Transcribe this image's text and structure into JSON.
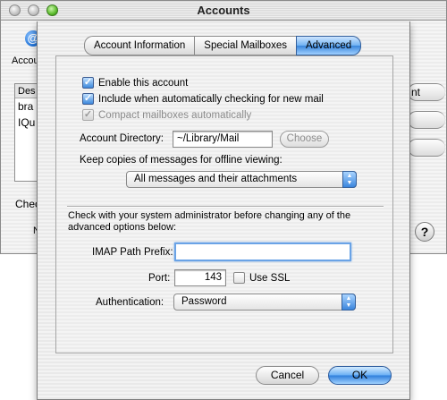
{
  "window": {
    "title": "Accounts",
    "toolbar_label": "Accou",
    "toolbar_icon_glyph": "@",
    "list_header": "Des",
    "list_rows": [
      "bra",
      "IQu"
    ],
    "side_button_label": "nt",
    "check_label": "Chec",
    "n_label": "N",
    "help_glyph": "?"
  },
  "tabs": [
    {
      "label": "Account Information",
      "active": false
    },
    {
      "label": "Special Mailboxes",
      "active": false
    },
    {
      "label": "Advanced",
      "active": true
    }
  ],
  "options": {
    "enable_account": {
      "label": "Enable this account",
      "checked": true
    },
    "auto_check": {
      "label": "Include when automatically checking for new mail",
      "checked": true
    },
    "compact": {
      "label": "Compact mailboxes automatically",
      "checked": true,
      "enabled": false
    }
  },
  "account_directory": {
    "label": "Account Directory:",
    "value": "~/Library/Mail",
    "choose_label": "Choose"
  },
  "offline": {
    "label": "Keep copies of messages for offline viewing:",
    "selected": "All messages and their attachments"
  },
  "admin_note": "Check with your system administrator before changing any of the advanced options below:",
  "imap": {
    "prefix_label": "IMAP Path Prefix:",
    "prefix_value": "",
    "port_label": "Port:",
    "port_value": "143",
    "ssl_label": "Use SSL",
    "ssl_checked": false,
    "auth_label": "Authentication:",
    "auth_selected": "Password"
  },
  "buttons": {
    "cancel": "Cancel",
    "ok": "OK"
  },
  "glyphs": {
    "check": "✓",
    "arrows_up": "▲",
    "arrows_down": "▼"
  },
  "colors": {
    "accent": "#3a86dc",
    "focus_ring": "#6aa3e6"
  }
}
